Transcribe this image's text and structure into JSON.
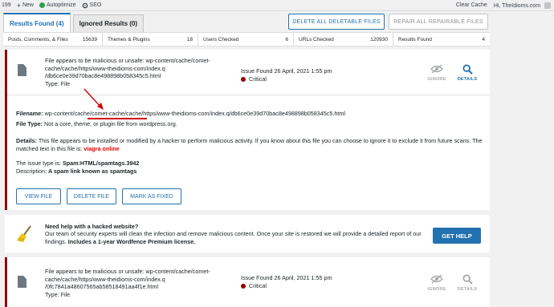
{
  "adminbar": {
    "count": "199",
    "new_label": "New",
    "autoptimize_label": "Autoptimize",
    "seo_label": "SEO",
    "clear_cache_label": "Clear Cache",
    "greeting": "Hi, TheIdioms.com"
  },
  "tabs": [
    {
      "label": "Results Found (4)"
    },
    {
      "label": "Ignored Results (0)"
    }
  ],
  "buttons": {
    "delete_all": "DELETE ALL DELETABLE FILES",
    "repair_all": "REPAIR ALL REPAIRABLE FILES",
    "view_file": "VIEW FILE",
    "delete_file": "DELETE FILE",
    "mark_fixed": "MARK AS FIXED",
    "get_help": "GET HELP"
  },
  "stats": [
    {
      "label": "Posts, Comments, & Files",
      "value": "15639"
    },
    {
      "label": "Themes & Plugins",
      "value": "18"
    },
    {
      "label": "Users Checked",
      "value": "6"
    },
    {
      "label": "URLs Checked",
      "value": "120930"
    },
    {
      "label": "Results Found",
      "value": "4"
    }
  ],
  "issue1": {
    "line1": "File appears to be malicious or unsafe: wp-content/cache/comet-",
    "line2": "cache/cache/https/www-theidioms-com/index.q",
    "line3": "/db6ce0e39d70bac8e498898b058345c5.html",
    "type": "Type: File",
    "found": "Issue Found 26 April, 2021 1:55 pm",
    "severity": "Critical",
    "ignore": "IGNORE",
    "details": "DETAILS"
  },
  "detail": {
    "filename_label": "Filename:",
    "filename_pre": "wp-content/cache",
    "filename_mid": "/comet-cache/cache/",
    "filename_post": "https/www-theidioms-com/index.q/db6ce0e39d70bac8e498898b058345c5.html",
    "filetype_label": "File Type:",
    "filetype_value": "Not a core, theme, or plugin file from wordpress.org.",
    "details_label": "Details:",
    "details_text": "This file appears to be installed or modified by a hacker to perform malicious activity. If you know about this file you can choose to ignore it to exclude it from future scans.",
    "matched_text": "The matched text in this file is:",
    "matched_value": "viagra online",
    "issue_type_label": "The issue type is:",
    "issue_type_value": "Spam:HTML/spamtags.3942",
    "description_label": "Description:",
    "description_value": "A spam link known as spamtags"
  },
  "help": {
    "title": "Need help with a hacked website?",
    "body": "Our team of security experts will clean the infection and remove malicious content. Once your site is restored we will provide a detailed report of our findings.",
    "bold": "Includes a 1-year Wordfence Premium license."
  },
  "issue2": {
    "line1": "File appears to be malicious or unsafe: wp-content/cache/comet-",
    "line2": "cache/cache/https/www-theidioms-com/index.q",
    "line3": "/0fc7841a48607565ab58518491aa4f1e.html",
    "type": "Type: File",
    "found": "Issue Found 26 April, 2021 1:55 pm",
    "severity": "Critical",
    "ignore": "IGNORE",
    "details": "DETAILS"
  },
  "colors": {
    "accent": "#2271b1",
    "critical": "#930000",
    "annotation": "#d40000",
    "matched": "#e00000"
  }
}
